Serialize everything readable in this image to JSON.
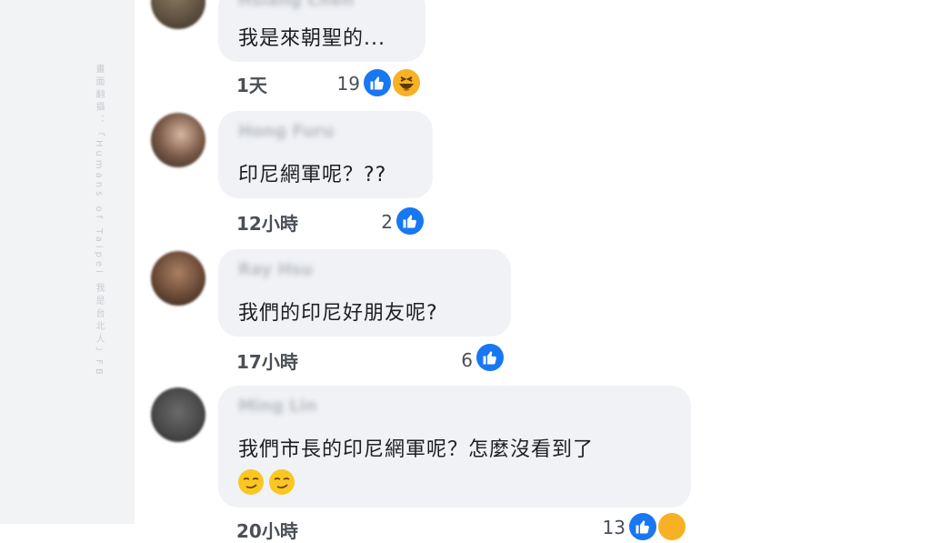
{
  "sidebar": {
    "watermark": "畫面翻攝：「Humans of Taipei 我是台北人」FB"
  },
  "comments": [
    {
      "author": "Hsiang Chen",
      "text": "我是來朝聖的...",
      "time": "1天",
      "reaction_count": "19",
      "reactions": [
        "like-icon",
        "haha-icon"
      ]
    },
    {
      "author": "Hong Furu",
      "text": "印尼網軍呢？??",
      "time": "12小時",
      "reaction_count": "2",
      "reactions": [
        "like-icon"
      ]
    },
    {
      "author": "Ray Hsu",
      "text": "我們的印尼好朋友呢?",
      "time": "17小時",
      "reaction_count": "6",
      "reactions": [
        "like-icon"
      ]
    },
    {
      "author": "Ming Lin",
      "text": "我們市長的印尼網軍呢？怎麼沒看到了",
      "emojis": [
        "smirk-emoji",
        "smirk-emoji"
      ],
      "time": "20小時",
      "reaction_count": "13",
      "reactions": [
        "like-icon",
        "haha-icon"
      ]
    }
  ],
  "colors": {
    "like_blue": "#1877f2",
    "bubble_gray": "#f0f2f5",
    "haha_yellow": "#f7b125"
  }
}
